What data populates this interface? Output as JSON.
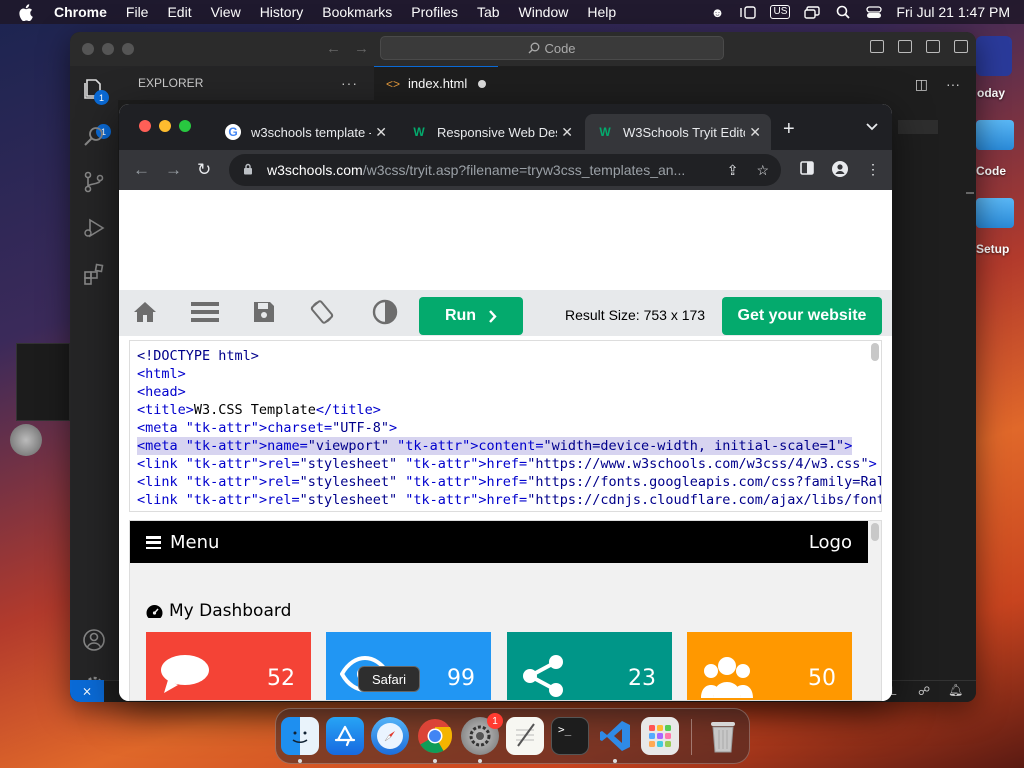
{
  "menubar": {
    "app": "Chrome",
    "items": [
      "File",
      "Edit",
      "View",
      "History",
      "Bookmarks",
      "Profiles",
      "Tab",
      "Window",
      "Help"
    ],
    "input_source": "US",
    "datetime": "Fri Jul 21  1:47 PM"
  },
  "desktop": {
    "labels": [
      "oday",
      "Code",
      "Setup"
    ]
  },
  "vscode": {
    "search_placeholder": "Code",
    "explorer_title": "EXPLORER",
    "explorer_more": "···",
    "tab_label": "index.html",
    "source_control_badge": "1"
  },
  "chrome": {
    "tabs": [
      {
        "title": "w3schools template -",
        "favicon": "google-icon"
      },
      {
        "title": "Responsive Web Desi",
        "favicon": "w3schools-icon"
      },
      {
        "title": "W3Schools Tryit Edito",
        "favicon": "w3schools-icon"
      }
    ],
    "active_tab": 2,
    "url_host": "w3schools.com",
    "url_path": "/w3css/tryit.asp?filename=tryw3css_templates_an..."
  },
  "tryit": {
    "run_label": "Run",
    "result_size": "Result Size: 753 x 173",
    "get_website": "Get your website",
    "code_lines": [
      "<!DOCTYPE html>",
      "<html>",
      "<head>",
      "<title>W3.CSS Template</title>",
      "<meta charset=\"UTF-8\">",
      "<meta name=\"viewport\" content=\"width=device-width, initial-scale=1\">",
      "<link rel=\"stylesheet\" href=\"https://www.w3schools.com/w3css/4/w3.css\">",
      "<link rel=\"stylesheet\" href=\"https://fonts.googleapis.com/css?family=Raleway\">",
      "<link rel=\"stylesheet\" href=\"https://cdnjs.cloudflare.com/ajax/libs/font-"
    ],
    "highlighted_line": 5
  },
  "result": {
    "menu": "Menu",
    "logo": "Logo",
    "dashboard_title": "My Dashboard",
    "cards": [
      {
        "value": "52",
        "color": "#f44336",
        "icon": "comment-icon"
      },
      {
        "value": "99",
        "color": "#2196f3",
        "icon": "eye-icon"
      },
      {
        "value": "23",
        "color": "#009688",
        "icon": "share-icon"
      },
      {
        "value": "50",
        "color": "#ff9800",
        "icon": "users-icon"
      }
    ]
  },
  "tooltip": "Safari",
  "dock": {
    "apps": [
      "Finder",
      "App Store",
      "Safari",
      "Chrome",
      "System Settings",
      "TextEdit",
      "Terminal",
      "Visual Studio Code",
      "Launchpad",
      "Trash"
    ],
    "settings_badge": "1"
  }
}
